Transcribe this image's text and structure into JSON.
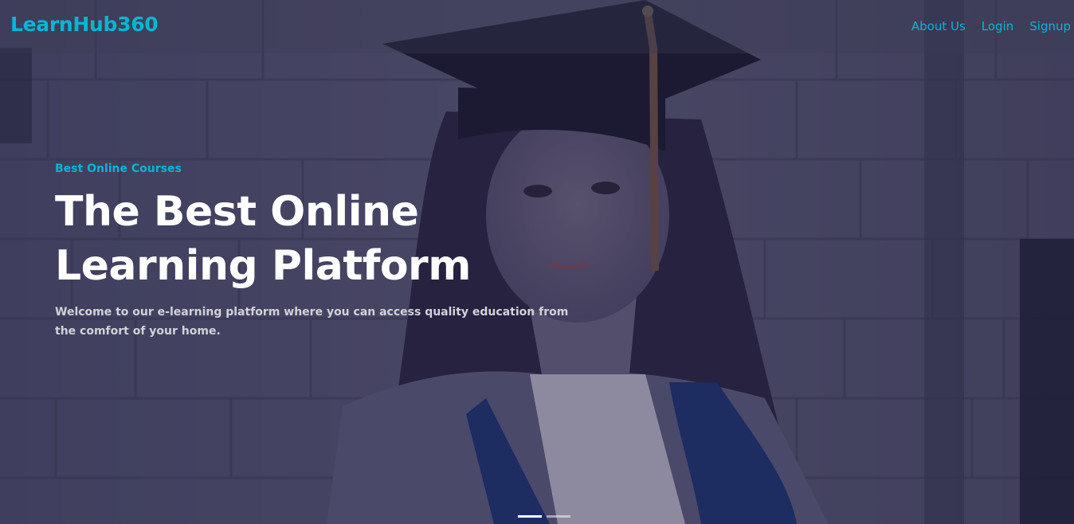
{
  "navbar": {
    "brand": "LearnHub360",
    "links": [
      {
        "label": "About Us"
      },
      {
        "label": "Login"
      },
      {
        "label": "Signup"
      }
    ]
  },
  "hero": {
    "eyebrow": "Best Online Courses",
    "headline": "The Best Online Learning Platform",
    "lead": "Welcome to our e-learning platform where you can access quality education from the comfort of your home.",
    "background_image": "graduate-student-photo",
    "carousel": {
      "slide_count": 2,
      "active_index": 0
    }
  },
  "colors": {
    "accent": "#06b6d4",
    "headline": "#ffffff",
    "lead": "#d2d2d8"
  }
}
